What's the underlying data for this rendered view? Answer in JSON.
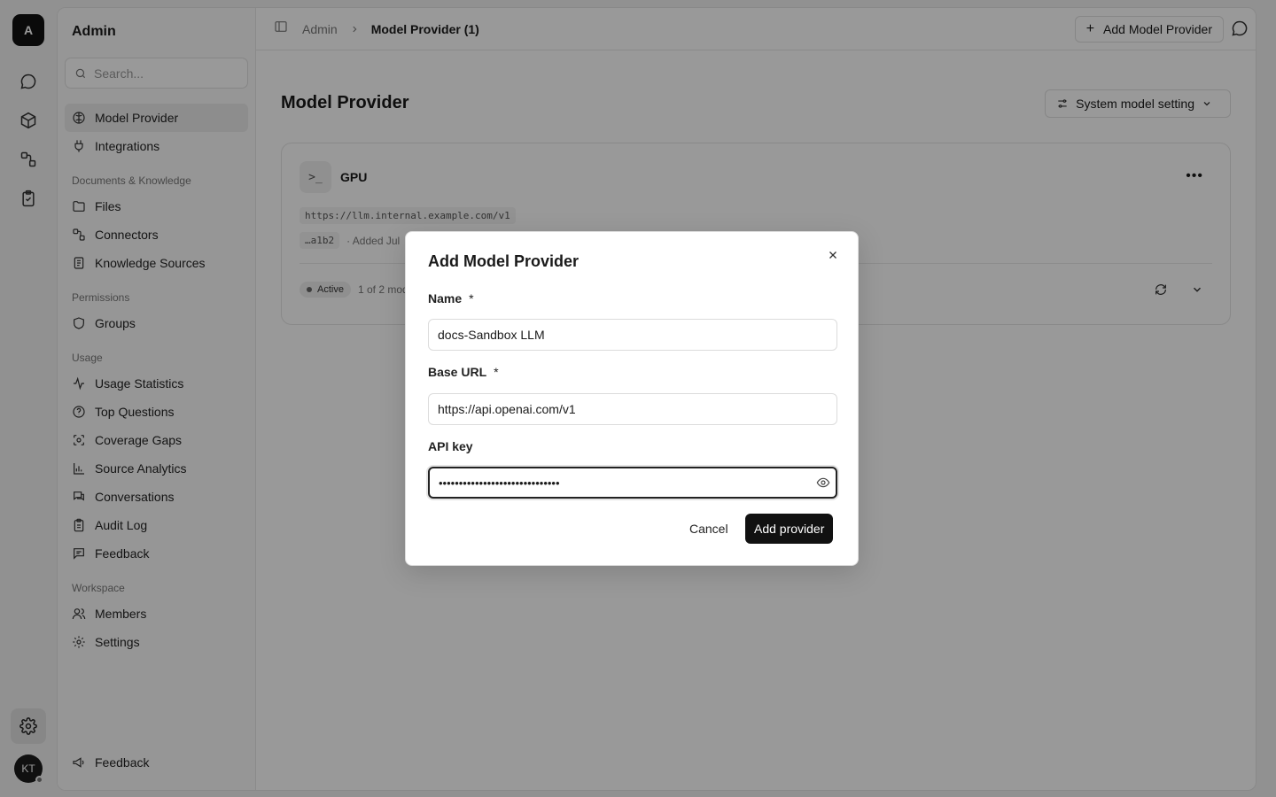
{
  "rail": {
    "logo_letter": "A",
    "avatar_initials": "KT"
  },
  "sidebar": {
    "title": "Admin",
    "search_placeholder": "Search...",
    "top_items": [
      {
        "label": "Model Provider",
        "icon": "brain-icon",
        "active": true
      },
      {
        "label": "Integrations",
        "icon": "plug-icon"
      }
    ],
    "sections": [
      {
        "label": "Documents & Knowledge",
        "items": [
          {
            "label": "Files",
            "icon": "folder-icon"
          },
          {
            "label": "Connectors",
            "icon": "connector-icon"
          },
          {
            "label": "Knowledge Sources",
            "icon": "book-icon"
          }
        ]
      },
      {
        "label": "Permissions",
        "items": [
          {
            "label": "Groups",
            "icon": "shield-icon"
          }
        ]
      },
      {
        "label": "Usage",
        "items": [
          {
            "label": "Usage Statistics",
            "icon": "activity-icon"
          },
          {
            "label": "Top Questions",
            "icon": "help-circle-icon"
          },
          {
            "label": "Coverage Gaps",
            "icon": "scan-icon"
          },
          {
            "label": "Source Analytics",
            "icon": "bar-chart-icon"
          },
          {
            "label": "Conversations",
            "icon": "messages-icon"
          },
          {
            "label": "Audit Log",
            "icon": "clipboard-icon"
          },
          {
            "label": "Feedback",
            "icon": "message-square-icon"
          }
        ]
      },
      {
        "label": "Workspace",
        "items": [
          {
            "label": "Members",
            "icon": "users-icon"
          },
          {
            "label": "Settings",
            "icon": "gear-icon"
          }
        ]
      }
    ],
    "footer_item": {
      "label": "Feedback",
      "icon": "megaphone-icon"
    }
  },
  "topbar": {
    "breadcrumb_root": "Admin",
    "breadcrumb_current": "Model Provider (1)",
    "add_button_label": "Add Model Provider"
  },
  "page": {
    "title": "Model Provider",
    "system_setting_label": "System model setting"
  },
  "provider_card": {
    "icon_text": ">_",
    "name": "GPU",
    "url": "https://llm.internal.example.com/v1",
    "key_suffix": "…a1b2",
    "added_text": "· Added Jul",
    "status": "Active",
    "models_text": "1 of 2 mod"
  },
  "modal": {
    "title": "Add Model Provider",
    "name_label": "Name",
    "name_value": "docs-Sandbox LLM",
    "base_url_label": "Base URL",
    "base_url_value": "https://api.openai.com/v1",
    "api_key_label": "API key",
    "api_key_value": "••••••••••••••••••••••••••••••",
    "required_mark": "*",
    "cancel_label": "Cancel",
    "submit_label": "Add provider"
  }
}
